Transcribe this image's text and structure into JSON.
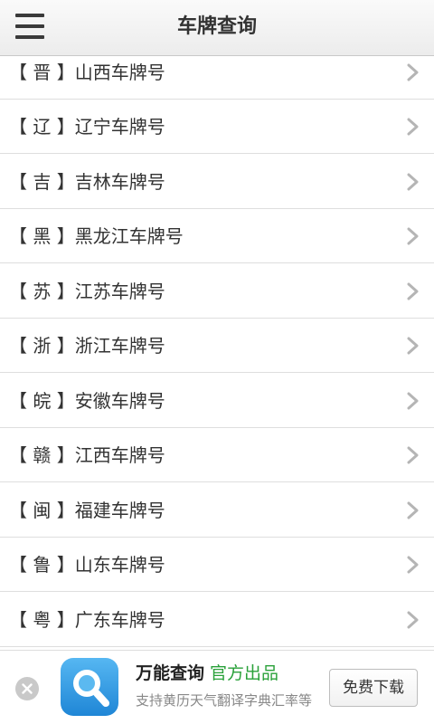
{
  "header": {
    "title": "车牌查询",
    "menu_icon": "hamburger-menu-icon"
  },
  "list": {
    "chevron_icon": "chevron-right-icon",
    "items": [
      {
        "label": "【 晋 】山西车牌号"
      },
      {
        "label": "【 辽 】辽宁车牌号"
      },
      {
        "label": "【 吉 】吉林车牌号"
      },
      {
        "label": "【 黑 】黑龙江车牌号"
      },
      {
        "label": "【 苏 】江苏车牌号"
      },
      {
        "label": "【 浙 】浙江车牌号"
      },
      {
        "label": "【 皖 】安徽车牌号"
      },
      {
        "label": "【 赣 】江西车牌号"
      },
      {
        "label": "【 闽 】福建车牌号"
      },
      {
        "label": "【 鲁 】山东车牌号"
      },
      {
        "label": "【 粤 】广东车牌号"
      }
    ]
  },
  "ad": {
    "app_name": "万能查询",
    "tag": "官方出品",
    "subtitle": "支持黄历天气翻译字典汇率等",
    "download_label": "免费下载",
    "icon": "magnifier-app-icon",
    "close_icon": "close-icon"
  },
  "colors": {
    "tag_green": "#2aa13a",
    "icon_blue": "#2b8fdc",
    "text": "#333333",
    "divider": "#dedede"
  }
}
